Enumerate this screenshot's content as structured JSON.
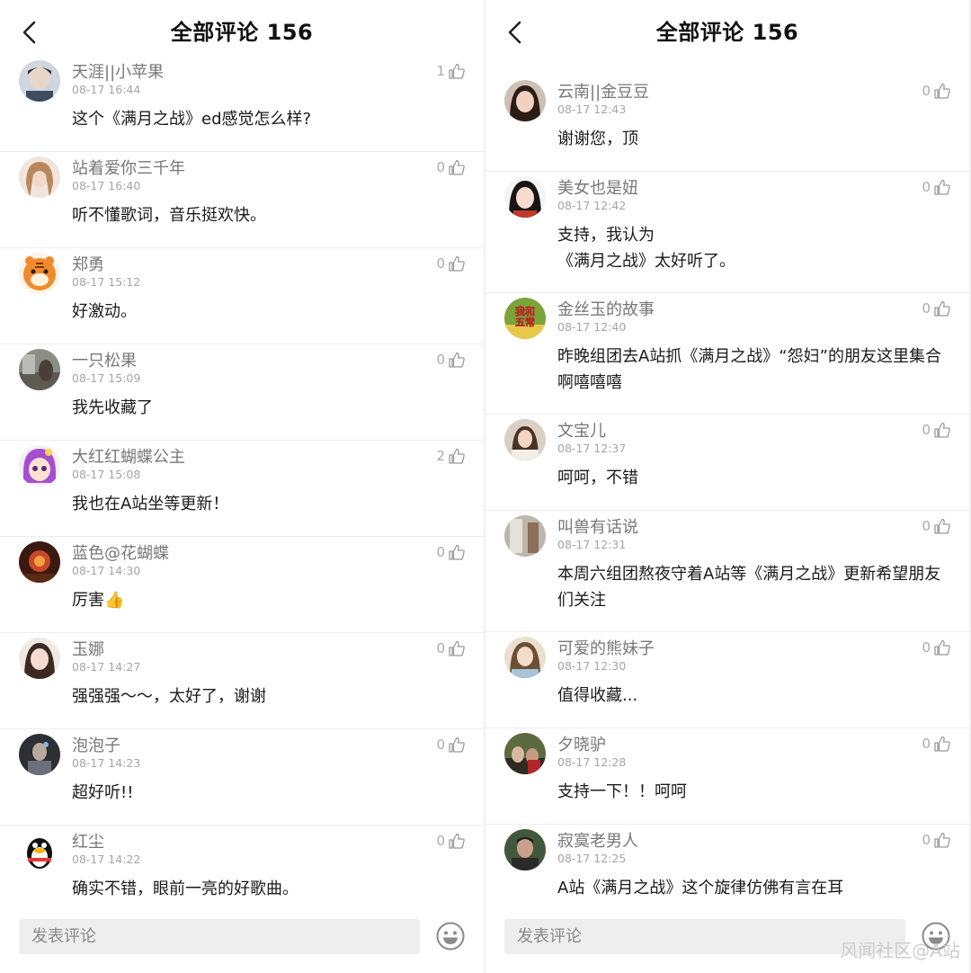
{
  "left": {
    "title": "全部评论 156",
    "input_placeholder": "发表评论",
    "comments": [
      {
        "name": "天涯||小苹果",
        "time": "08-17 16:44",
        "likes": "1",
        "text": "这个《满月之战》ed感觉怎么样?"
      },
      {
        "name": "站着爱你三千年",
        "time": "08-17 16:40",
        "likes": "0",
        "text": "听不懂歌词，音乐挺欢快。"
      },
      {
        "name": "郑勇",
        "time": "08-17 15:12",
        "likes": "0",
        "text": "好激动。"
      },
      {
        "name": "一只松果",
        "time": "08-17 15:09",
        "likes": "0",
        "text": "我先收藏了"
      },
      {
        "name": "大红红蝴蝶公主",
        "time": "08-17 15:08",
        "likes": "2",
        "text": "我也在A站坐等更新！"
      },
      {
        "name": "蓝色@花蝴蝶",
        "time": "08-17 14:30",
        "likes": "0",
        "text": "厉害👍"
      },
      {
        "name": "玉娜",
        "time": "08-17 14:27",
        "likes": "0",
        "text": "强强强～～，太好了，谢谢"
      },
      {
        "name": "泡泡子",
        "time": "08-17 14:23",
        "likes": "0",
        "text": "超好听!!"
      },
      {
        "name": "红尘",
        "time": "08-17 14:22",
        "likes": "0",
        "text": "确实不错，眼前一亮的好歌曲。"
      }
    ]
  },
  "right": {
    "title": "全部评论 156",
    "input_placeholder": "发表评论",
    "comments": [
      {
        "name": "云南||金豆豆",
        "time": "08-17 12:43",
        "likes": "0",
        "text": "谢谢您，顶"
      },
      {
        "name": "美女也是妞",
        "time": "08-17 12:42",
        "likes": "0",
        "text": "支持，我认为\n《满月之战》太好听了。"
      },
      {
        "name": "金丝玉的故事",
        "time": "08-17 12:40",
        "likes": "0",
        "text": "昨晚组团去A站抓《满月之战》“怨妇”的朋友这里集合\n啊嘻嘻嘻"
      },
      {
        "name": "文宝儿",
        "time": "08-17 12:37",
        "likes": "0",
        "text": "呵呵，不错"
      },
      {
        "name": "叫兽有话说",
        "time": "08-17 12:31",
        "likes": "0",
        "text": "本周六组团熬夜守着A站等《满月之战》更新希望朋友\n们关注"
      },
      {
        "name": "可爱的熊妹子",
        "time": "08-17 12:30",
        "likes": "0",
        "text": "值得收藏..."
      },
      {
        "name": "夕晓驴",
        "time": "08-17 12:28",
        "likes": "0",
        "text": "支持一下！！呵呵"
      },
      {
        "name": "寂寞老男人",
        "time": "08-17 12:25",
        "likes": "0",
        "text": "A站《满月之战》这个旋律仿佛有言在耳"
      }
    ],
    "avatar_badge": "我和\n五常"
  },
  "watermark": "风闻社区@A站",
  "colors": {
    "accent_text": "#1a1a1a",
    "meta": "#a5a5a5",
    "name": "#777777",
    "divider": "#ededed"
  }
}
